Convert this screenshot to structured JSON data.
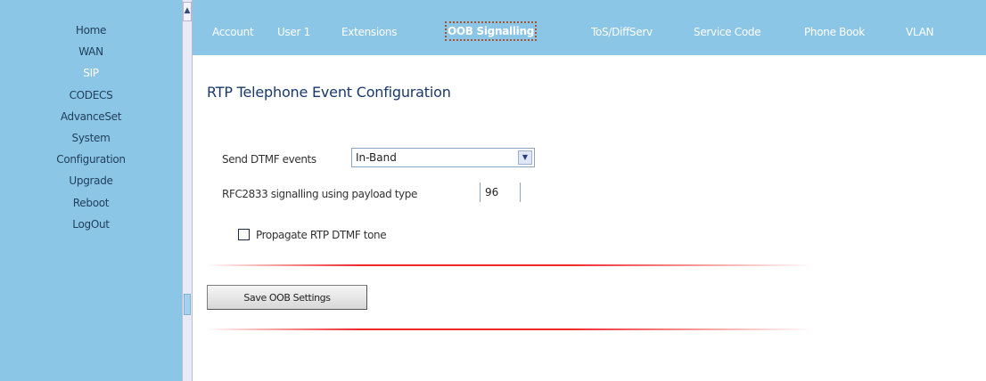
{
  "sidebar": {
    "items": [
      {
        "label": "Home",
        "active": false
      },
      {
        "label": "WAN",
        "active": false
      },
      {
        "label": "SIP",
        "active": true
      },
      {
        "label": "CODECS",
        "active": false
      },
      {
        "label": "AdvanceSet",
        "active": false
      },
      {
        "label": "System",
        "active": false
      },
      {
        "label": "Configuration",
        "active": false
      },
      {
        "label": "Upgrade",
        "active": false
      },
      {
        "label": "Reboot",
        "active": false
      },
      {
        "label": "LogOut",
        "active": false
      }
    ]
  },
  "tabs": [
    {
      "label": "Account",
      "active": false
    },
    {
      "label": "User 1",
      "active": false
    },
    {
      "label": "Extensions",
      "active": false
    },
    {
      "label": "OOB Signalling",
      "active": true
    },
    {
      "label": "ToS/DiffServ",
      "active": false
    },
    {
      "label": "Service Code",
      "active": false
    },
    {
      "label": "Phone Book",
      "active": false
    },
    {
      "label": "VLAN",
      "active": false
    }
  ],
  "main": {
    "title": "RTP Telephone Event Configuration",
    "dtmf": {
      "label": "Send DTMF events",
      "value": "In-Band"
    },
    "payload": {
      "label": "RFC2833 signalling using payload type",
      "value": "96"
    },
    "passthru": {
      "label": "Propagate RTP DTMF tone",
      "checked": false
    },
    "save_button": "Save OOB Settings"
  },
  "colors": {
    "nav_background": "#8cc6e7",
    "active_nav_text": "#ffffff",
    "title_text": "#19396b",
    "divider": "#ef2a2a",
    "active_tab_outline": "#a4542e"
  },
  "icons": {
    "scroll_up": "chevron-up-icon",
    "select_arrow": "chevron-down-icon"
  }
}
